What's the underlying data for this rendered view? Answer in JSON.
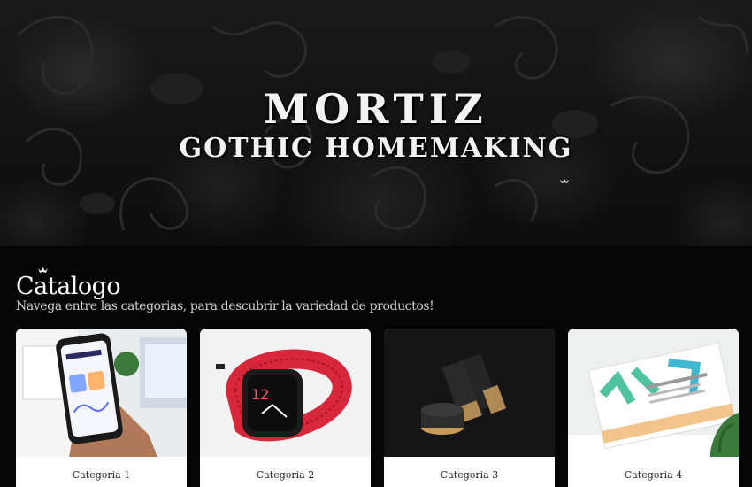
{
  "hero": {
    "title": "MORTIZ",
    "subtitle": "GOTHIC HOMEMAKING",
    "background": "dark-damask-pattern"
  },
  "catalog": {
    "title": "Catalogo",
    "subtitle": "Navega entre las categorias, para descubrir la variedad de productos!",
    "cards": [
      {
        "label": "Categoria 1",
        "image": "smartphone-app-photo"
      },
      {
        "label": "Categoria 2",
        "image": "red-smartwatch-photo"
      },
      {
        "label": "Categoria 3",
        "image": "cosmetics-jars-photo"
      },
      {
        "label": "Categoria 4",
        "image": "book-photo"
      }
    ]
  },
  "colors": {
    "background": "#050505",
    "card": "#ffffff",
    "text": "#ffffff"
  }
}
